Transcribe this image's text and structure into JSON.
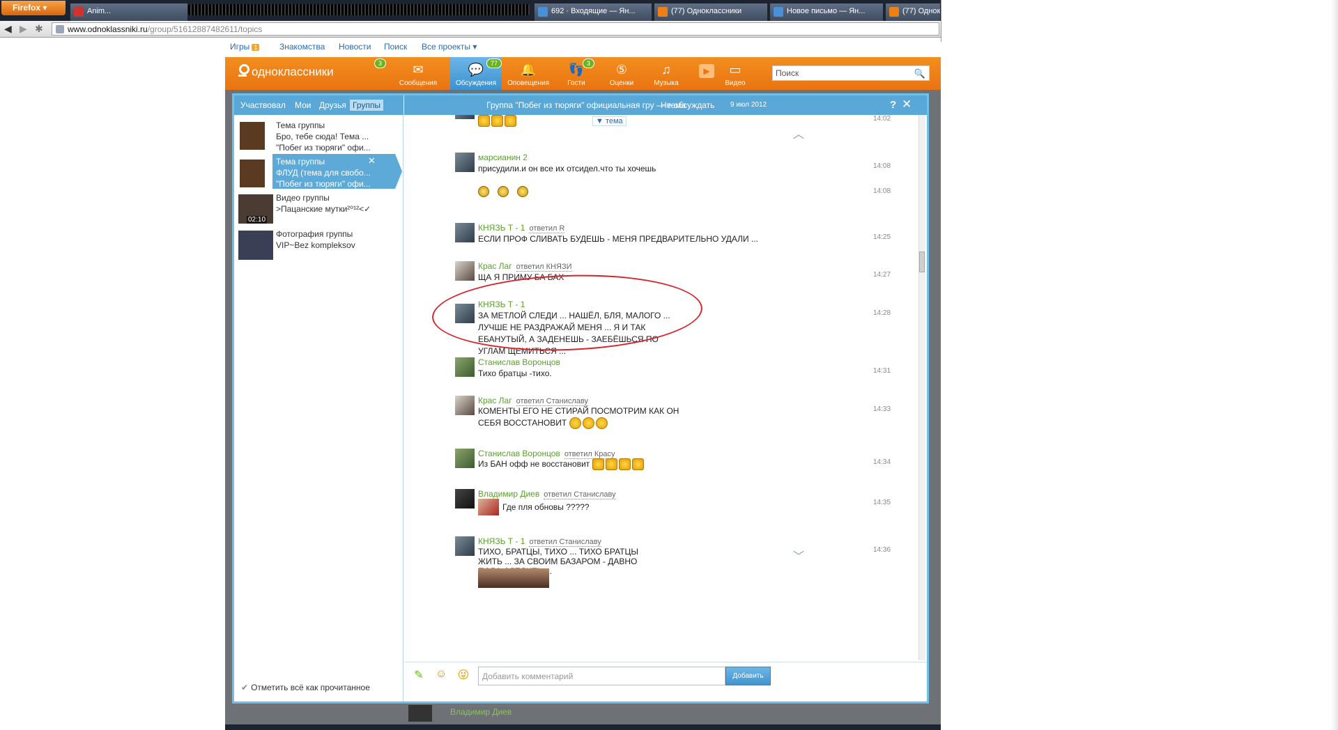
{
  "browser": {
    "menu_button": "Firefox",
    "tabs": [
      {
        "label": "Anim..."
      },
      {
        "label": "692 · Входящие — Ян..."
      },
      {
        "label": "(77) Одноклассники"
      },
      {
        "label": "Новое письмо — Ян..."
      },
      {
        "label": "(77) Однок..."
      }
    ],
    "url_domain": "www.odnoklassniki.ru",
    "url_path": "/group/51612887482611/topics"
  },
  "colors": {
    "brand_orange": "#ee7f15",
    "accent_blue": "#5aa8d8",
    "name_green": "#5aa02c",
    "circle_red": "#d9232a"
  },
  "toplinks": {
    "games": "Игры",
    "games_badge": "1",
    "dating": "Знакомства",
    "news": "Новости",
    "search": "Поиск",
    "all_projects": "Все проекты ▾"
  },
  "header": {
    "logo": "одноклассники",
    "logo_badge": "3",
    "items": [
      {
        "label": "Сообщения",
        "icon": "envelope-icon"
      },
      {
        "label": "Обсуждения",
        "icon": "speech-bubble-icon",
        "badge": "77"
      },
      {
        "label": "Оповещения",
        "icon": "bell-icon"
      },
      {
        "label": "Гости",
        "icon": "footprints-icon",
        "badge": "3"
      },
      {
        "label": "Оценки",
        "icon": "five-rating-icon"
      },
      {
        "label": "Музыка",
        "icon": "music-note-icon"
      },
      {
        "label": "Видео",
        "icon": "video-icon"
      }
    ],
    "search_placeholder": "Поиск"
  },
  "left": {
    "tabs": [
      "Участвовал",
      "Мои",
      "Друзья",
      "Группы"
    ],
    "items": [
      {
        "l1": "Тема группы",
        "l2": "Бро, тебе сюда! Тема ...",
        "l3": "\"Побег из тюряги\" офи..."
      },
      {
        "l1": "Тема группы",
        "l2": "ФЛУД (тема для свобо...",
        "l3": "\"Побег из тюряги\" офи..."
      },
      {
        "l1": "Видео группы",
        "l2": ">Пацанские мутки²⁰¹²<✓",
        "time": "02:10"
      },
      {
        "l1": "Фотография группы",
        "l2": "VIP~Bez kompleksov"
      }
    ],
    "mark_read": "Отметить всё как прочитанное"
  },
  "main": {
    "title": "Группа \"Побег из тюряги\" официальная гру — тема",
    "no_discuss": "Не обсуждать",
    "date": "9 июл 2012",
    "help": "?",
    "topic_chip": "▼ тема",
    "messages": [
      {
        "time": "14:02"
      },
      {
        "name": "марсианин 2",
        "text": "присудили.и он все  их отсидел.что ты хочешь",
        "time": "14:08"
      },
      {
        "time": "14:08"
      },
      {
        "name": "КНЯЗЬ Т - 1",
        "reply": "ответил R",
        "text": "ЕСЛИ ПРОФ СЛИВАТЬ БУДЕШЬ - МЕНЯ ПРЕДВАРИТЕЛЬНО УДАЛИ ...",
        "time": "14:25"
      },
      {
        "name": "Крас Лаг",
        "reply": "ответил КНЯЗИ",
        "text": "ЩА Я ПРИМУ БА БАХ",
        "time": "14:27"
      },
      {
        "name": "КНЯЗЬ Т - 1",
        "text": "ЗА МЕТЛОЙ СЛЕДИ ... НАШЁЛ, БЛЯ, МАЛОГО ... ЛУЧШЕ НЕ РАЗДРАЖАЙ МЕНЯ ... Я И ТАК ЕБАНУТЫЙ, А ЗАДЕНЕШЬ - ЗАЕБЁШЬСЯ ПО УГЛАМ ЩЕМИТЬСЯ ...",
        "time": "14:28"
      },
      {
        "name": "Станислав Воронцов",
        "text": "Тихо братцы -тихо.",
        "time": "14:31"
      },
      {
        "name": "Крас Лаг",
        "reply": "ответил Станиславу",
        "text": "КОМЕНТЫ ЕГО НЕ СТИРАЙ ПОСМОТРИМ КАК ОН СЕБЯ ВОССТАНОВИТ",
        "time": "14:33"
      },
      {
        "name": "Станислав Воронцов",
        "reply": "ответил Красу",
        "text": "Из БАН офф не восстановит",
        "time": "14:34"
      },
      {
        "name": "Владимир Диев",
        "reply": "ответил Станиславу",
        "text": "Где пля обновы ?????",
        "time": "14:35"
      },
      {
        "name": "КНЯЗЬ Т - 1",
        "reply": "ответил Станиславу",
        "text": "ТИХО, БРАТЦЫ, ТИХО ... ТИХО БРАТЦЫ ЖИТЬ ... ЗА СВОИМ БАЗАРОМ - ДАВНО ПОРА СЛЕДИТЬ ...",
        "time": "14:36"
      }
    ],
    "comment_placeholder": "Добавить комментарий",
    "add_button": "Добавить"
  },
  "below": {
    "name": "Владимир Диев"
  }
}
